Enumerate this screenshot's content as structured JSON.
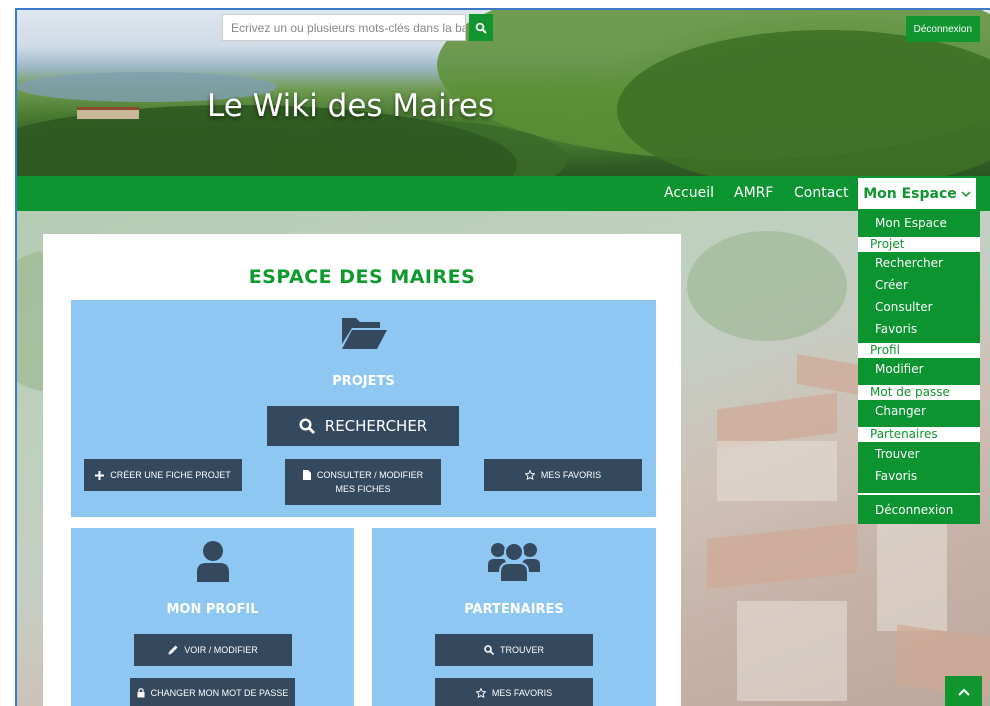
{
  "header": {
    "site_title": "Le Wiki des Maires",
    "search_placeholder": "Ecrivez un ou plusieurs mots-clés dans la ba",
    "logout_label": "Déconnexion"
  },
  "nav": {
    "items": [
      {
        "label": "Accueil"
      },
      {
        "label": "AMRF"
      },
      {
        "label": "Contact"
      }
    ],
    "espace_label": "Mon Espace"
  },
  "dropdown": {
    "mon_espace": "Mon Espace",
    "projet_header": "Projet",
    "rechercher": "Rechercher",
    "creer": "Créer",
    "consulter": "Consulter",
    "favoris_projet": "Favoris",
    "profil_header": "Profil",
    "modifier": "Modifier",
    "mdp_header": "Mot de passe",
    "changer": "Changer",
    "partenaires_header": "Partenaires",
    "trouver": "Trouver",
    "favoris_partenaires": "Favoris",
    "deconnexion": "Déconnexion"
  },
  "main": {
    "title": "ESPACE DES MAIRES",
    "projets": {
      "title": "PROJETS",
      "search_button": "RECHERCHER",
      "create_button": "CRÉER UNE FICHE PROJET",
      "consult_line1": "CONSULTER / MODIFIER",
      "consult_line2": "MES FICHES",
      "favorites_button": "MES FAVORIS"
    },
    "profil": {
      "title": "MON PROFIL",
      "view_button": "VOIR / MODIFIER",
      "password_button": "CHANGER MON MOT DE PASSE"
    },
    "partenaires": {
      "title": "PARTENAIRES",
      "find_button": "TROUVER",
      "favorites_button": "MES FAVORIS"
    }
  },
  "colors": {
    "brand_green": "#0c9430",
    "panel_blue": "#8fc7f3",
    "button_navy": "#34495e"
  },
  "icons": [
    "search-icon",
    "folder-open-icon",
    "plus-icon",
    "file-icon",
    "star-icon",
    "user-icon",
    "users-icon",
    "pencil-icon",
    "lock-icon",
    "chevron-down-icon",
    "chevron-up-icon"
  ]
}
